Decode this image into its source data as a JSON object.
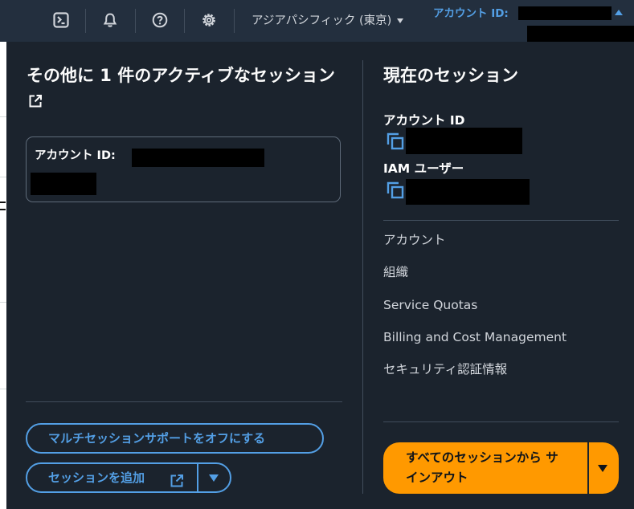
{
  "topbar": {
    "icons": [
      "cloudshell-icon",
      "bell-icon",
      "help-icon",
      "gear-icon"
    ],
    "region_label": "アジアパシフィック (東京)",
    "account_menu_label": "アカウント ID:"
  },
  "other_sessions": {
    "title": "その他に 1 件のアクティブなセッション",
    "card_label": "アカウント ID:",
    "turn_off_multisession_label": "マルチセッションサポートをオフにする",
    "add_session_label": "セッションを追加"
  },
  "current_session": {
    "title": "現在のセッション",
    "account_id_label": "アカウント ID",
    "iam_user_label": "IAM ユーザー",
    "links": [
      "アカウント",
      "組織",
      "Service Quotas",
      "Billing and Cost Management",
      "セキュリティ認証情報"
    ],
    "signout_label": "すべてのセッションから サインアウト"
  },
  "colors": {
    "nav_bg": "#232f3e",
    "panel_bg": "#1b232d",
    "accent_blue": "#539fe5",
    "signout_orange": "#ff9900"
  }
}
